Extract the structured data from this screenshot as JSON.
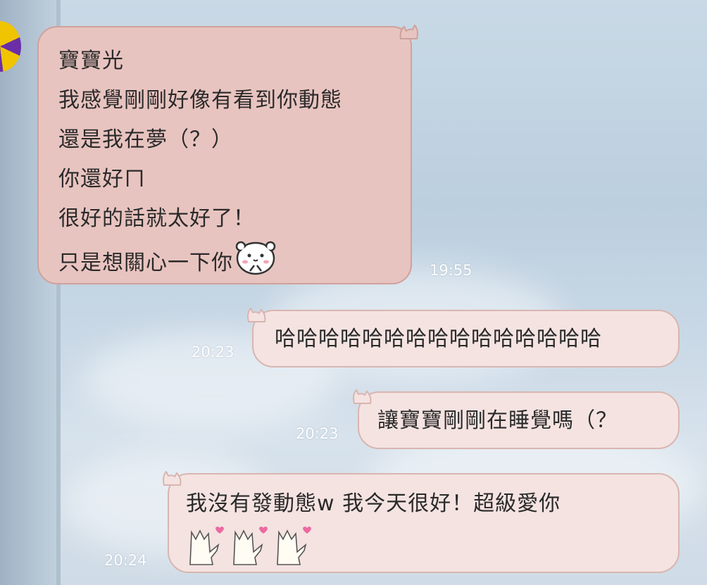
{
  "messages": [
    {
      "direction": "incoming",
      "lines": [
        "寶寶光",
        "我感覺剛剛好像有看到你動態",
        "還是我在夢（？）",
        "你還好ㄇ",
        "很好的話就太好了！",
        "只是想關心一下你"
      ],
      "time": "19:55",
      "sticker": "bear-face-icon"
    },
    {
      "direction": "outgoing",
      "text": "哈哈哈哈哈哈哈哈哈哈哈哈哈哈哈",
      "time": "20:23"
    },
    {
      "direction": "outgoing",
      "text": "讓寶寶剛剛在睡覺嗎（？",
      "time": "20:23"
    },
    {
      "direction": "outgoing",
      "text": "我沒有發動態w 我今天很好！超級愛你",
      "time": "20:24",
      "sticker": "dancing-cats-icon"
    }
  ],
  "colors": {
    "incoming_bubble": "#e8c4c0",
    "outgoing_bubble": "#f4e3e1",
    "time_text": "#ffffff"
  }
}
